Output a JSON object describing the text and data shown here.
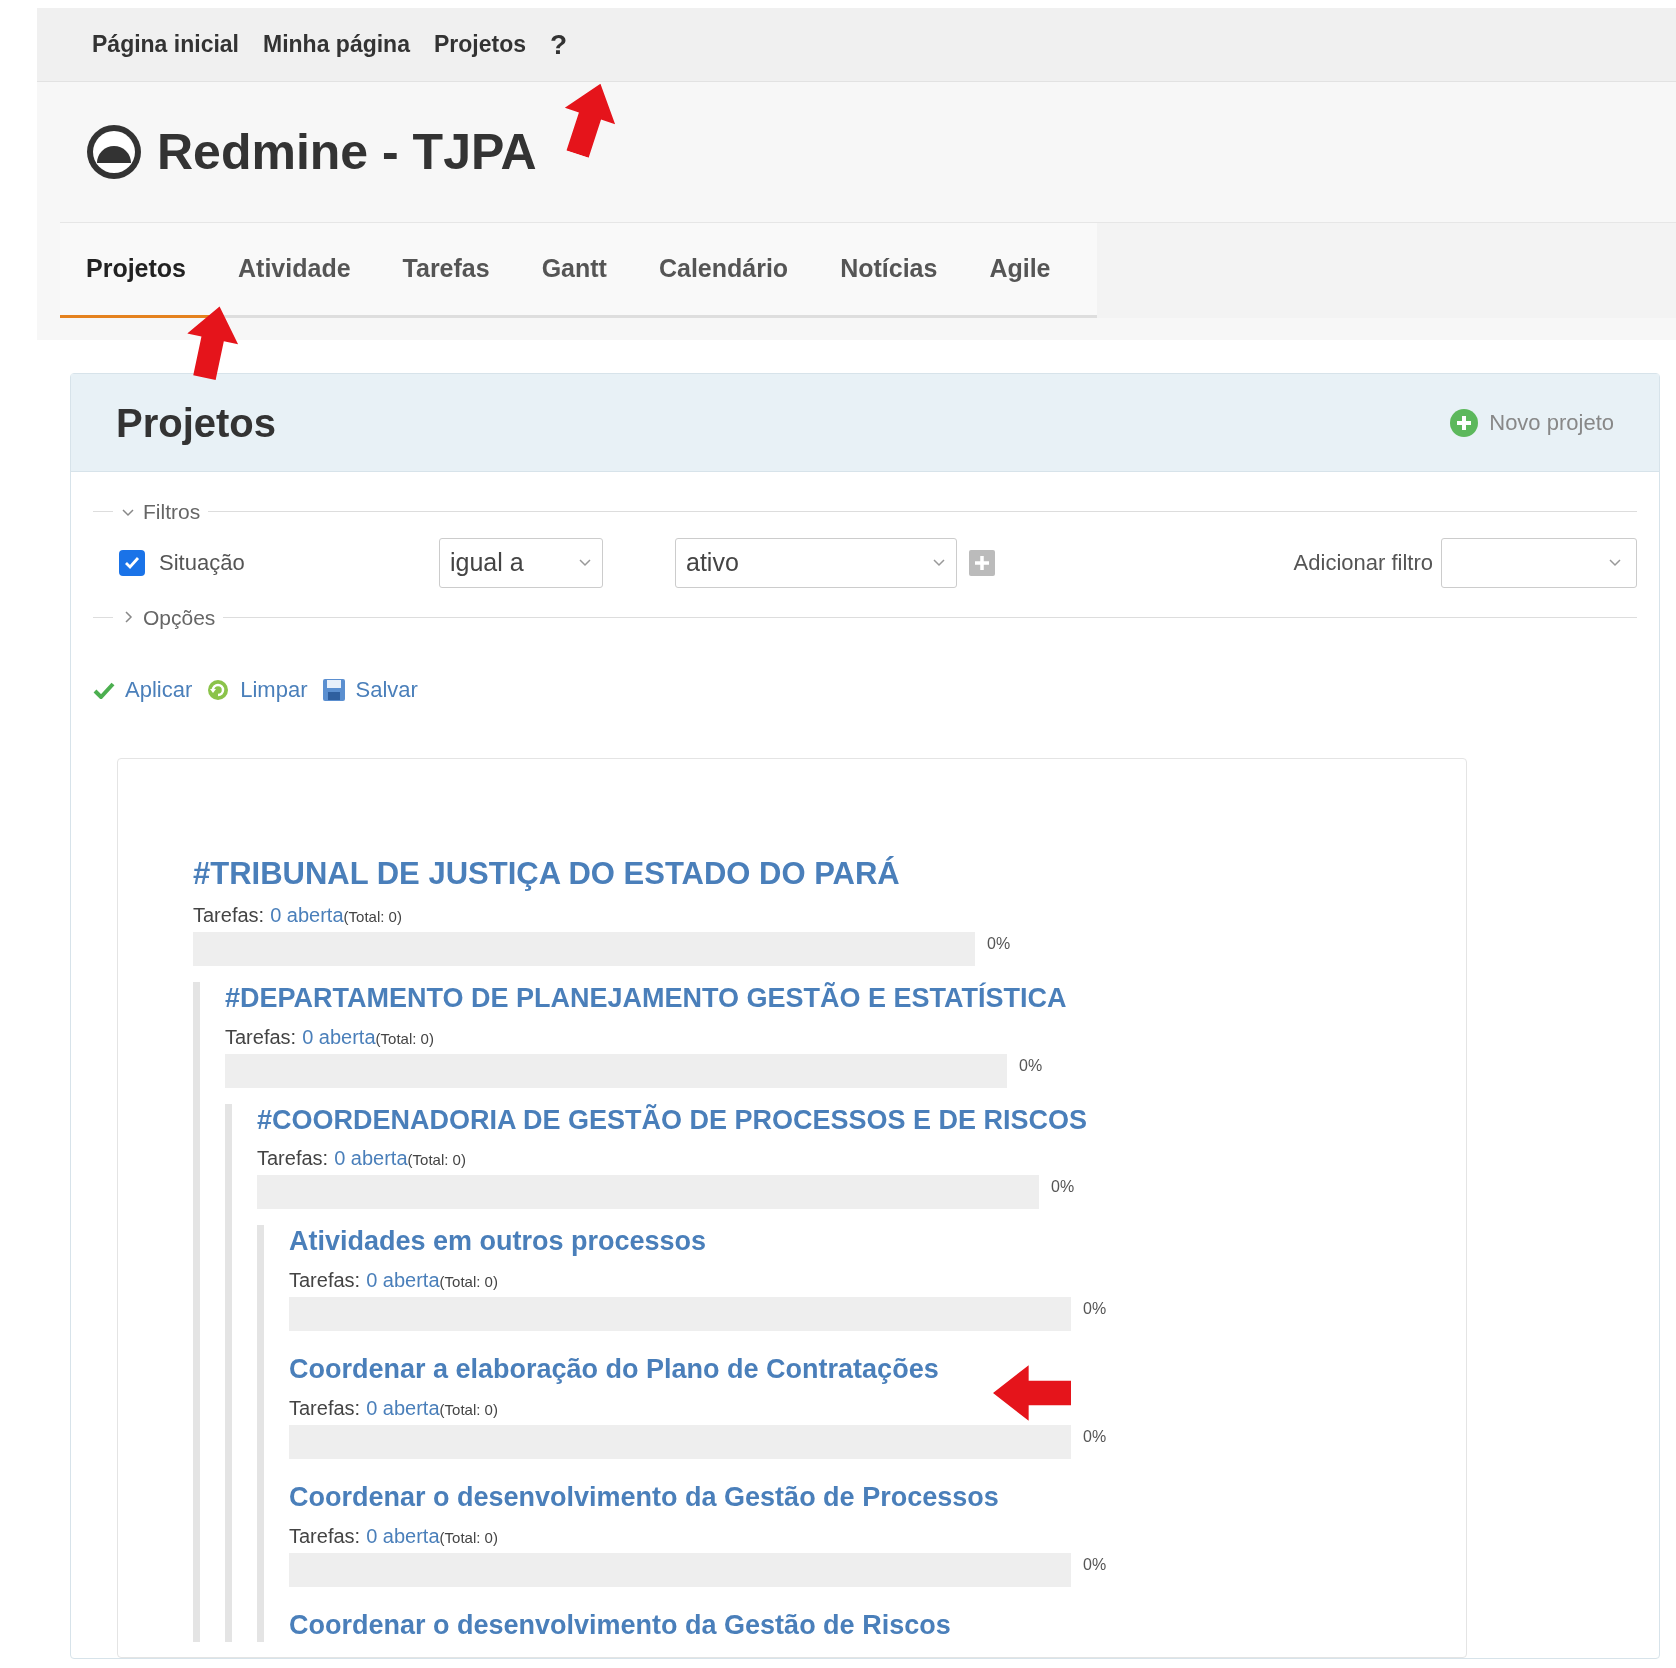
{
  "top_menu": [
    {
      "label": "Página inicial"
    },
    {
      "label": "Minha página"
    },
    {
      "label": "Projetos"
    }
  ],
  "help": "?",
  "site_title": "Redmine - TJPA",
  "tabs": [
    {
      "label": "Projetos",
      "selected": true
    },
    {
      "label": "Atividade",
      "selected": false
    },
    {
      "label": "Tarefas",
      "selected": false
    },
    {
      "label": "Gantt",
      "selected": false
    },
    {
      "label": "Calendário",
      "selected": false
    },
    {
      "label": "Notícias",
      "selected": false
    },
    {
      "label": "Agile",
      "selected": false
    }
  ],
  "panel": {
    "title": "Projetos",
    "new_project": "Novo projeto"
  },
  "filters": {
    "legend": "Filtros",
    "expanded": true,
    "rows": [
      {
        "checked": true,
        "label": "Situação",
        "operator": "igual a",
        "value": "ativo"
      }
    ],
    "add_filter_label": "Adicionar filtro",
    "options_legend": "Opções",
    "options_expanded": false
  },
  "actions": [
    {
      "kind": "apply",
      "label": "Aplicar"
    },
    {
      "kind": "clear",
      "label": "Limpar"
    },
    {
      "kind": "save",
      "label": "Salvar"
    }
  ],
  "projects": [
    {
      "name": "#TRIBUNAL DE JUSTIÇA DO ESTADO DO PARÁ",
      "tasks": {
        "label": "Tarefas:",
        "open": "0 aberta",
        "total": "(Total: 0)"
      },
      "level": 0,
      "percent": "0%",
      "children": [
        {
          "name": "#DEPARTAMENTO DE PLANEJAMENTO GESTÃO E ESTATÍSTICA",
          "tasks": {
            "label": "Tarefas:",
            "open": "0 aberta",
            "total": "(Total: 0)"
          },
          "level": 0,
          "percent": "0%",
          "children": [
            {
              "name": "#COORDENADORIA DE GESTÃO DE PROCESSOS E DE RISCOS",
              "tasks": {
                "label": "Tarefas:",
                "open": "0 aberta",
                "total": "(Total: 0)"
              },
              "level": 0,
              "percent": "0%",
              "children": [
                {
                  "name": "Atividades em outros processos",
                  "tasks": {
                    "label": "Tarefas:",
                    "open": "0 aberta",
                    "total": "(Total: 0)"
                  },
                  "level": 0,
                  "percent": "0%"
                },
                {
                  "name": "Coordenar a elaboração do Plano de Contratações",
                  "tasks": {
                    "label": "Tarefas:",
                    "open": "0 aberta",
                    "total": "(Total: 0)"
                  },
                  "level": 0,
                  "percent": "0%"
                },
                {
                  "name": "Coordenar o desenvolvimento da Gestão de Processos",
                  "tasks": {
                    "label": "Tarefas:",
                    "open": "0 aberta",
                    "total": "(Total: 0)"
                  },
                  "level": 0,
                  "percent": "0%"
                },
                {
                  "name": "Coordenar o desenvolvimento da Gestão de Riscos"
                }
              ]
            }
          ]
        }
      ]
    }
  ]
}
